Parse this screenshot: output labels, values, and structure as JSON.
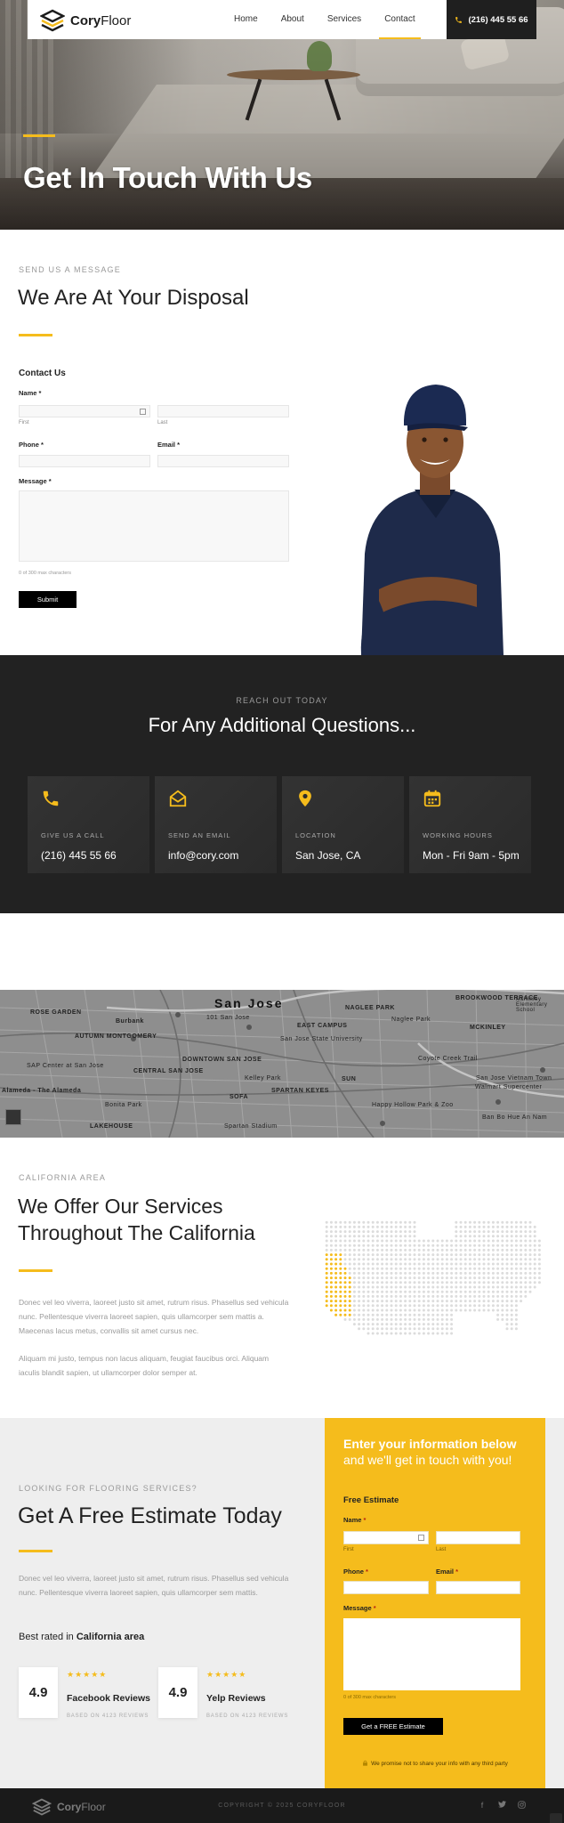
{
  "nav": {
    "brand_bold": "Cory",
    "brand_light": "Floor",
    "links": [
      "Home",
      "About",
      "Services",
      "Contact"
    ],
    "active": "Contact",
    "phone": "(216) 445 55 66"
  },
  "hero": {
    "title": "Get In Touch With Us"
  },
  "contact": {
    "eyebrow": "SEND US A MESSAGE",
    "title": "We Are At Your Disposal",
    "form_title": "Contact Us",
    "name_label": "Name",
    "first": "First",
    "last": "Last",
    "phone_label": "Phone",
    "email_label": "Email",
    "message_label": "Message",
    "count": "0 of 300 max characters",
    "required_mark": "*",
    "submit": "Submit"
  },
  "reach": {
    "eyebrow": "REACH OUT TODAY",
    "title": "For Any Additional Questions...",
    "cards": [
      {
        "icon": "phone-icon",
        "label": "GIVE US A CALL",
        "value": "(216) 445 55 66"
      },
      {
        "icon": "envelope-open-icon",
        "label": "SEND AN EMAIL",
        "value": "info@cory.com"
      },
      {
        "icon": "location-pin-icon",
        "label": "LOCATION",
        "value": "San Jose, CA"
      },
      {
        "icon": "calendar-icon",
        "label": "WORKING HOURS",
        "value": "Mon - Fri 9am - 5pm"
      }
    ]
  },
  "map": {
    "city": "San Jose",
    "labels": [
      "NAGLEE PARK",
      "BROOKWOOD TERRACE",
      "McKinley Elementary School",
      "AUTUMN MONTGOMERY",
      "101 San Jose",
      "EAST CAMPUS",
      "San Jose State University",
      "MCKINLEY",
      "SAP Center at San Jose",
      "DOWNTOWN SAN JOSE",
      "Kelley Park",
      "Alameda - The Alameda",
      "CENTRAL SAN JOSE",
      "SOFA",
      "SPARTAN KEYES",
      "San Jose Vietnam Town",
      "Walmart Supercenter",
      "Ban Bo Hue An Nam",
      "LAKEHOUSE",
      "Spartan Stadium",
      "SUN",
      "Burbank",
      "Happy Hollow Park & Zoo",
      "ROSE GARDEN",
      "Naglee Park",
      "Coyote Creek Trail",
      "Bonita Park"
    ]
  },
  "california": {
    "eyebrow": "CALIFORNIA AREA",
    "title_line1": "We Offer Our Services",
    "title_line2": "Throughout The California",
    "para1": "Donec vel leo viverra, laoreet justo sit amet, rutrum risus. Phasellus sed vehicula nunc. Pellentesque viverra laoreet sapien, quis ullamcorper sem mattis a. Maecenas lacus metus, convallis sit amet cursus nec.",
    "para2": "Aliquam mi justo, tempus non lacus aliquam, feugiat faucibus orci. Aliquam iaculis blandit sapien, ut ullamcorper dolor semper at."
  },
  "estimate": {
    "eyebrow": "LOOKING FOR FLOORING SERVICES?",
    "title": "Get A Free Estimate Today",
    "para": "Donec vel leo viverra, laoreet justo sit amet, rutrum risus. Phasellus sed vehicula nunc. Pellentesque viverra laoreet sapien, quis ullamcorper sem mattis.",
    "rated_prefix": "Best rated in ",
    "rated_area": "California area",
    "reviews": [
      {
        "score": "4.9",
        "stars": "★★★★★",
        "name": "Facebook Reviews",
        "based": "BASED ON 4123 REVIEWS"
      },
      {
        "score": "4.9",
        "stars": "★★★★★",
        "name": "Yelp Reviews",
        "based": "BASED ON 4123 REVIEWS"
      }
    ],
    "panel": {
      "title": "Enter your information below",
      "subtitle": "and we'll get in touch with you!",
      "form_title": "Free Estimate",
      "name_label": "Name",
      "first": "First",
      "last": "Last",
      "phone_label": "Phone",
      "email_label": "Email",
      "message_label": "Message",
      "count": "0 of 300 max characters",
      "required_mark": "*",
      "button": "Get a FREE Estimate",
      "privacy": "We promise not to share your info with any third party"
    }
  },
  "footer": {
    "brand_bold": "Cory",
    "brand_light": "Floor",
    "copyright": "COPYRIGHT © 2025 CORYFLOOR",
    "social": [
      "facebook-icon",
      "twitter-icon",
      "instagram-icon"
    ]
  },
  "colors": {
    "accent": "#f5bc1c",
    "dark": "#222222",
    "text": "#222222",
    "muted": "#9a9a9a"
  }
}
